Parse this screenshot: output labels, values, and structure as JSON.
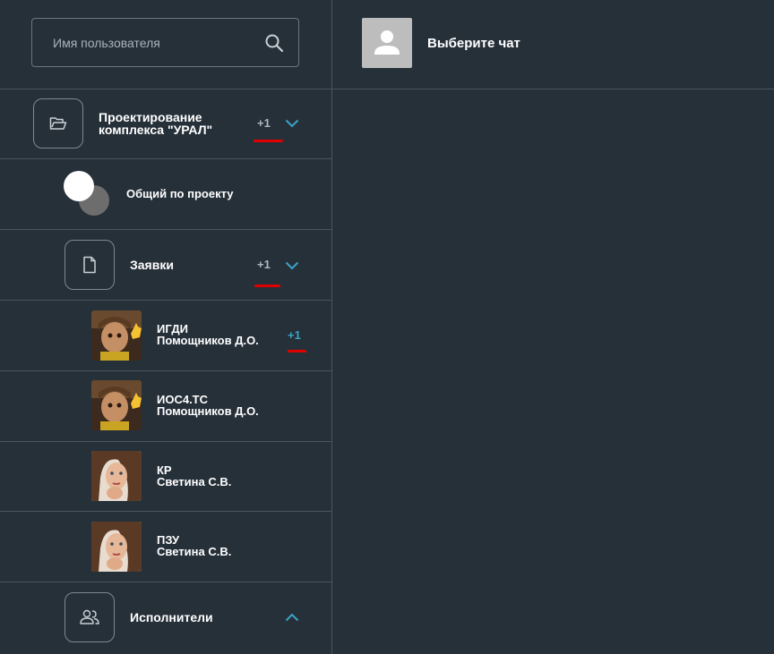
{
  "search": {
    "placeholder": "Имя пользователя",
    "icon": "search-icon"
  },
  "chat_header": {
    "title": "Выберите чат",
    "avatar_icon": "user-placeholder-icon"
  },
  "colors": {
    "accent": "#3aa4c7",
    "badge_muted": "#aeb7be",
    "underline": "#e00000",
    "background": "#263039"
  },
  "sidebar": {
    "project": {
      "line1": "Проектирование",
      "line2": "комплекса \"УРАЛ\"",
      "badge": "+1",
      "icon": "folder-icon",
      "chevron": "chevron-down-icon"
    },
    "general": {
      "label": "Общий по проекту",
      "icon": "toggle-avatar-icon"
    },
    "requests": {
      "label": "Заявки",
      "badge": "+1",
      "icon": "document-icon",
      "chevron": "chevron-down-icon"
    },
    "chats": [
      {
        "name": "ИГДИ",
        "person": "Помощников Д.О.",
        "badge": "+1"
      },
      {
        "name": "ИОС4.ТС",
        "person": "Помощников Д.О.",
        "badge": ""
      },
      {
        "name": "КР",
        "person": "Светина С.В.",
        "badge": ""
      },
      {
        "name": "ПЗУ",
        "person": "Светина С.В.",
        "badge": ""
      }
    ],
    "executors": {
      "label": "Исполнители",
      "icon": "users-icon",
      "chevron": "chevron-up-icon"
    }
  }
}
